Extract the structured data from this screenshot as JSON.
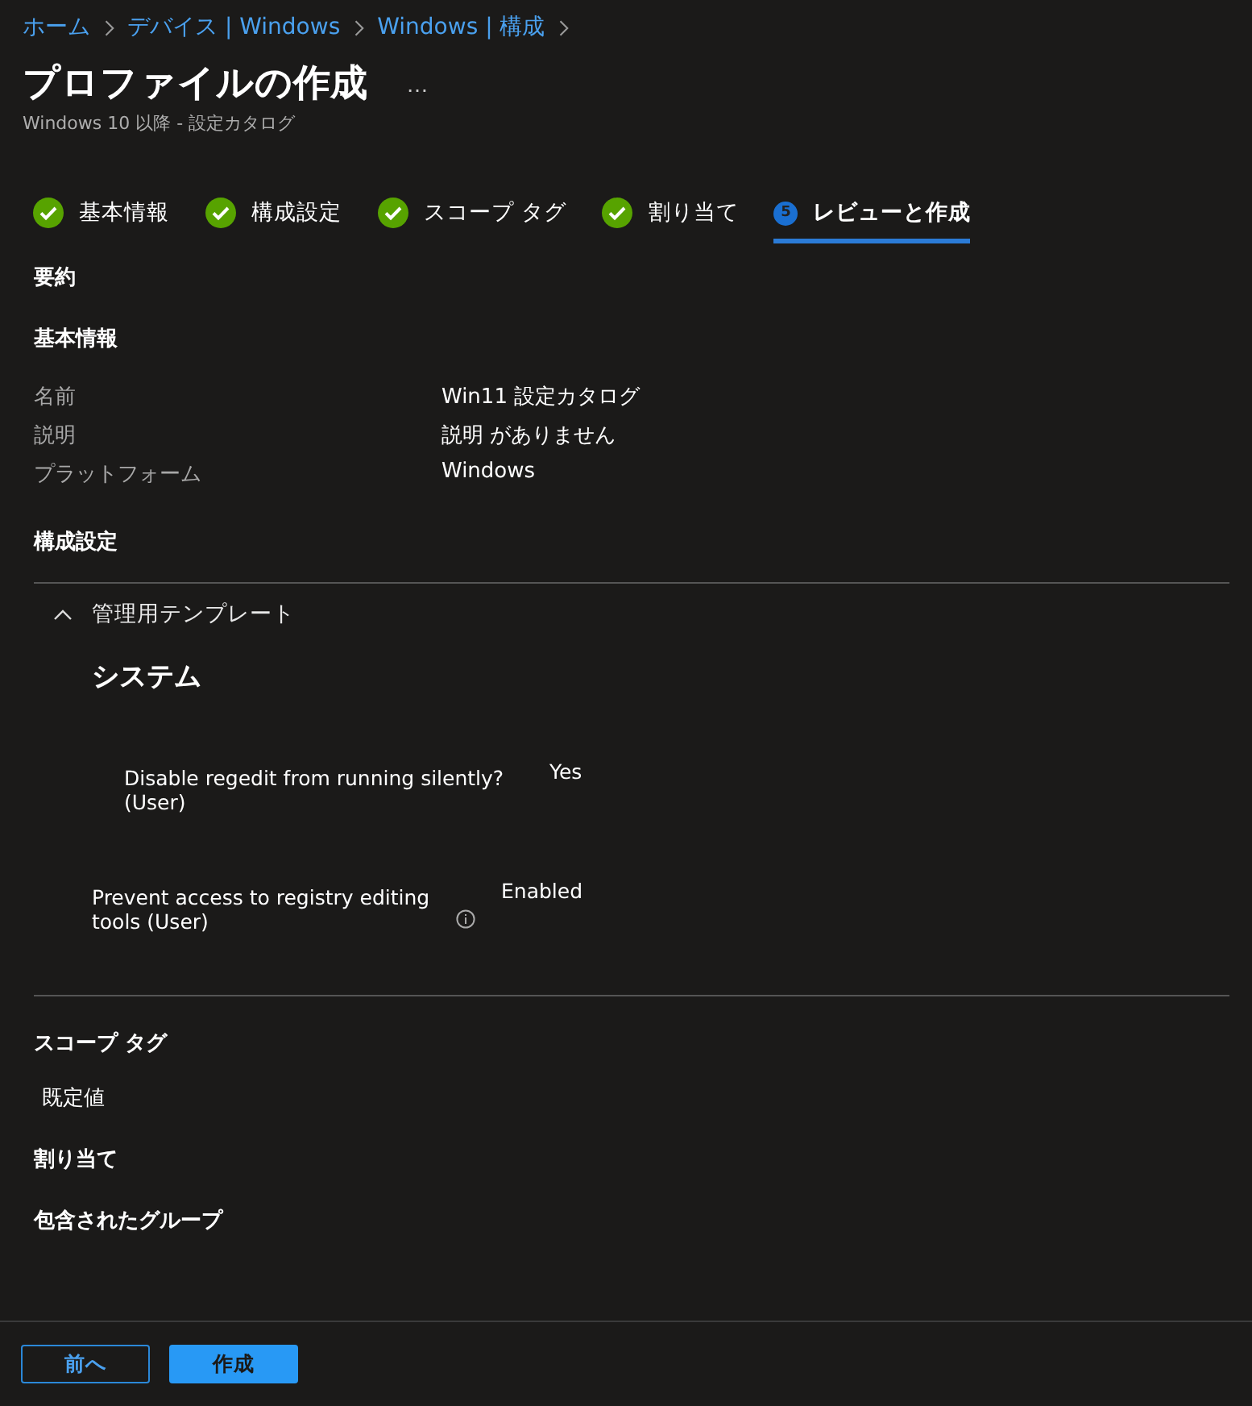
{
  "breadcrumb": [
    "ホーム",
    "デバイス | Windows",
    "Windows | 構成"
  ],
  "title": "プロファイルの作成",
  "more": "…",
  "subtitle": "Windows 10 以降 - 設定カタログ",
  "steps": [
    {
      "label": "基本情報",
      "complete": true,
      "selected": false
    },
    {
      "label": "構成設定",
      "complete": true,
      "selected": false
    },
    {
      "label": "スコープ タグ",
      "complete": true,
      "selected": false
    },
    {
      "label": "割り当て",
      "complete": true,
      "selected": false
    },
    {
      "label": "レビューと作成",
      "complete": false,
      "number": "5",
      "selected": true
    }
  ],
  "summary_heading": "要約",
  "basics": {
    "heading": "基本情報",
    "rows": [
      {
        "label": "名前",
        "value": "Win11 設定カタログ"
      },
      {
        "label": "説明",
        "value": "説明 がありません"
      },
      {
        "label": "プラットフォーム",
        "value": "Windows"
      }
    ]
  },
  "config": {
    "heading": "構成設定",
    "group": {
      "label": "管理用テンプレート",
      "expanded": true,
      "category": "システム",
      "settings": [
        {
          "kind": "sub",
          "name": "Disable regedit from running silently? (User)",
          "value": "Yes",
          "info": false
        },
        {
          "kind": "setting",
          "name": "Prevent access to registry editing tools (User)",
          "value": "Enabled",
          "info": true
        }
      ]
    }
  },
  "scope_tags": {
    "heading": "スコープ タグ",
    "value": "既定値"
  },
  "assignments": {
    "heading": "割り当て",
    "subheading": "包含されたグループ"
  },
  "footer": {
    "buttons": [
      {
        "label": "前へ",
        "kind": "secondary"
      },
      {
        "label": "作成",
        "kind": "primary"
      }
    ]
  }
}
